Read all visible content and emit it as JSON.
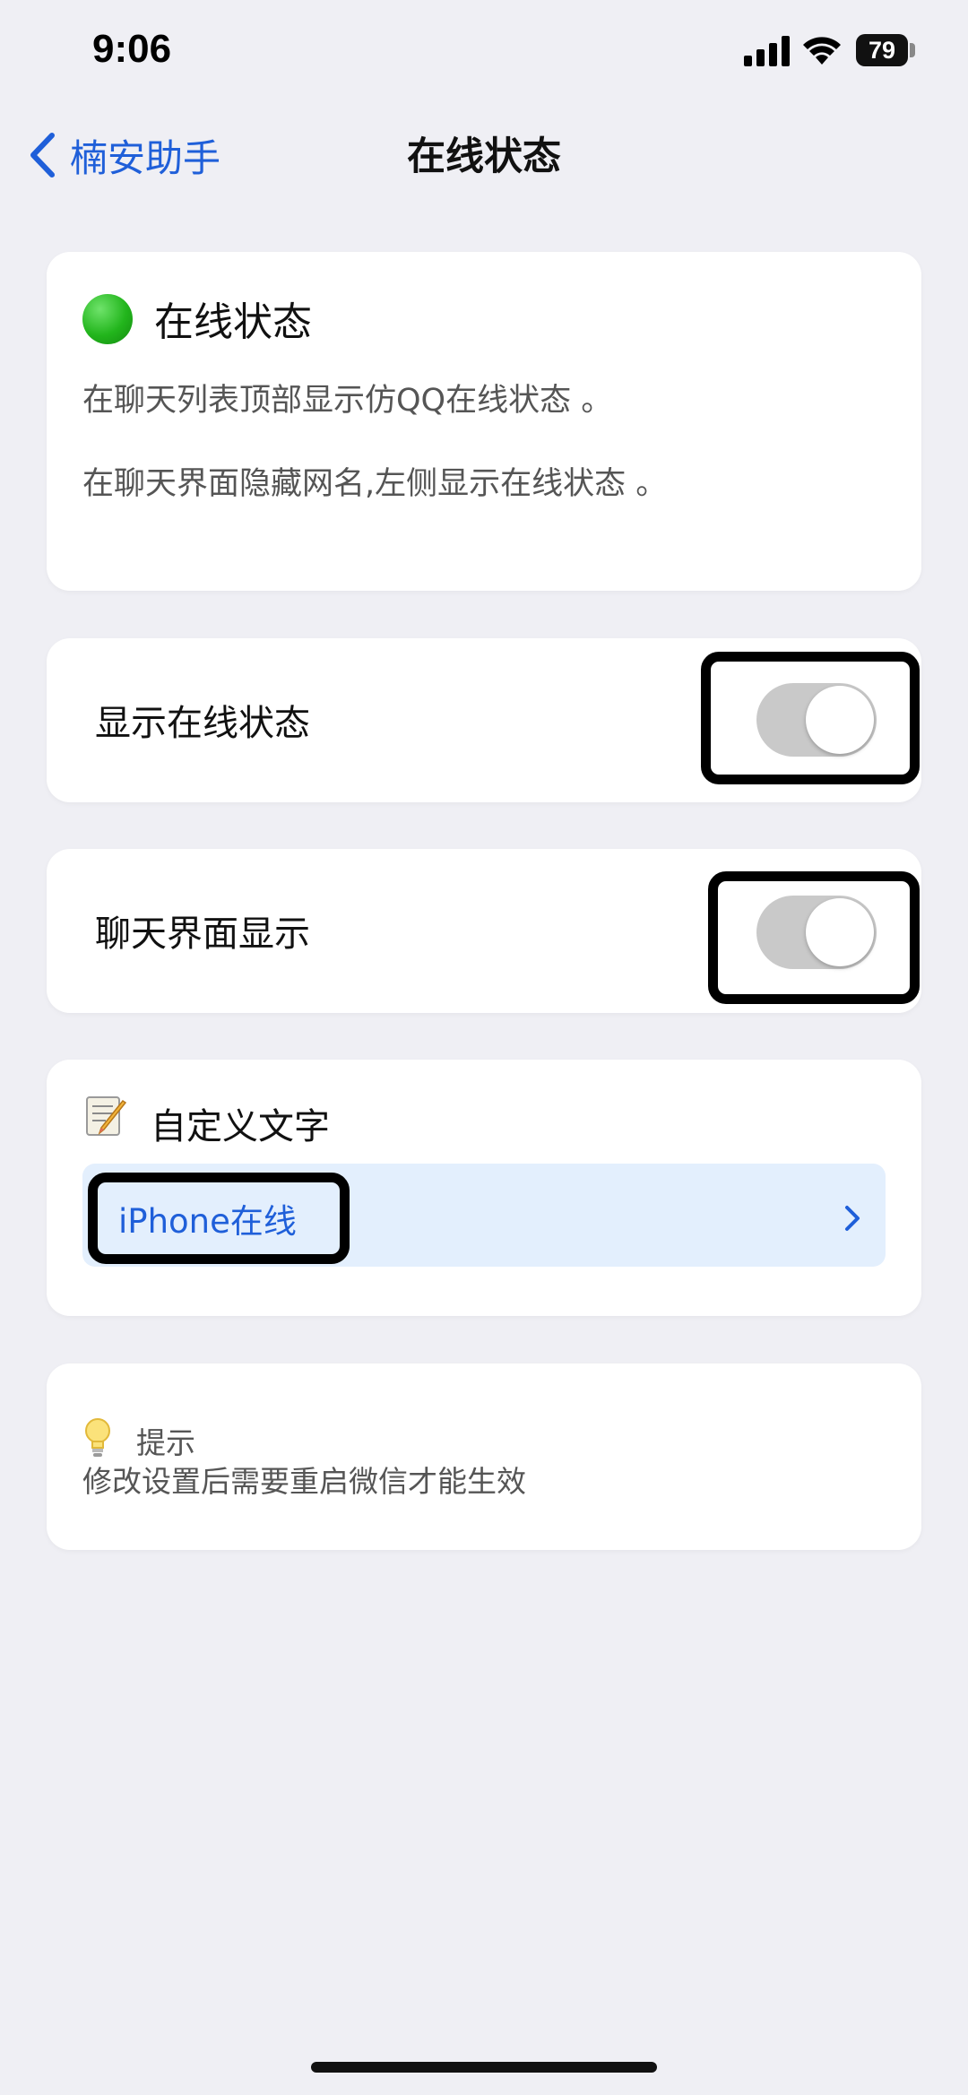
{
  "status_bar": {
    "time": "9:06",
    "battery": "79"
  },
  "nav": {
    "back_label": "楠安助手",
    "title": "在线状态"
  },
  "intro": {
    "title": "在线状态",
    "line1": "在聊天列表顶部显示仿QQ在线状态 。",
    "line2": "在聊天界面隐藏网名,左侧显示在线状态 。",
    "status_color": "#22b51c"
  },
  "toggles": [
    {
      "label": "显示在线状态",
      "on": false
    },
    {
      "label": "聊天界面显示",
      "on": false
    }
  ],
  "custom_text": {
    "title": "自定义文字",
    "value": "iPhone在线",
    "icon": "memo-icon"
  },
  "tip": {
    "title": "提示",
    "body": "修改设置后需要重启微信才能生效",
    "icon": "lightbulb-icon"
  },
  "colors": {
    "accent": "#1f5fd9",
    "background": "#efeff4",
    "card": "#ffffff",
    "highlight_row": "#e3effd"
  }
}
